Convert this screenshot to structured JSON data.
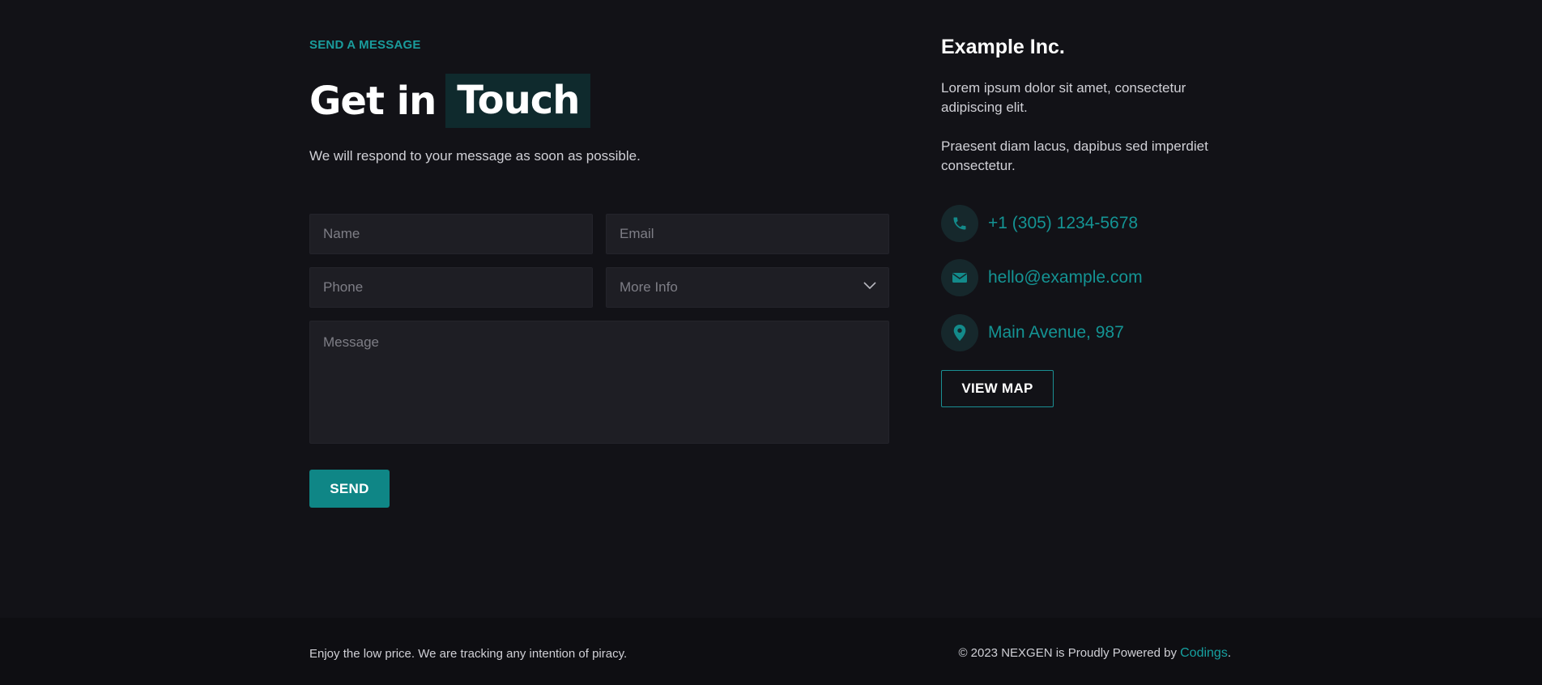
{
  "contact_form": {
    "eyebrow": "SEND A MESSAGE",
    "headline_plain": "Get in",
    "headline_highlight": "Touch",
    "intro": "We will respond to your message as soon as possible.",
    "name_placeholder": "Name",
    "email_placeholder": "Email",
    "phone_placeholder": "Phone",
    "more_info_selected": "More Info",
    "message_placeholder": "Message",
    "send_label": "SEND"
  },
  "company": {
    "name": "Example Inc.",
    "paragraph_1": "Lorem ipsum dolor sit amet, consectetur adipiscing elit.",
    "paragraph_2": "Praesent diam lacus, dapibus sed imperdiet consectetur.",
    "phone": "+1 (305) 1234-5678",
    "email": "hello@example.com",
    "address": "Main Avenue, 987",
    "view_map_label": "VIEW MAP",
    "icons": {
      "phone": "phone-icon",
      "email": "envelope-icon",
      "address": "map-pin-icon"
    }
  },
  "footer": {
    "left_text": "Enjoy the low price. We are tracking any intention of piracy.",
    "right_prefix": "© 2023 NEXGEN is Proudly Powered by ",
    "right_link": "Codings",
    "right_suffix": "."
  },
  "colors": {
    "background": "#121217",
    "footer_background": "#0e0e12",
    "accent": "#0f8686",
    "accent_text": "#149494",
    "field_background": "#1e1e24",
    "highlight_background": "#0f2a2d"
  }
}
